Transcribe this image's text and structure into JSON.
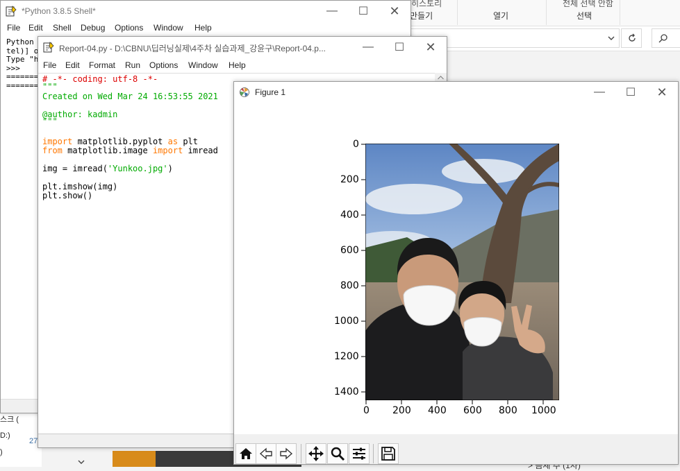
{
  "explorer": {
    "ribbon_groups": [
      "만들기",
      "열기",
      "선택"
    ],
    "ribbon_top_items": [
      "히스토리",
      "전체 선택 안함"
    ],
    "left_items": [
      "스크 (",
      "D:)",
      ")"
    ],
    "status_partial": "27",
    "bottom_right_partial": "> 음체 추 (1차)"
  },
  "shell": {
    "title": "*Python 3.8.5 Shell*",
    "menu": [
      "File",
      "Edit",
      "Shell",
      "Debug",
      "Options",
      "Window",
      "Help"
    ],
    "lines": [
      "Python",
      "tel)] o",
      "Type \"h",
      ">>> ",
      "=======",
      "======="
    ]
  },
  "editor": {
    "title": "Report-04.py - D:\\CBNU\\딥러닝실제\\4주차 실습과제_강윤구\\Report-04.p...",
    "menu": [
      "File",
      "Edit",
      "Format",
      "Run",
      "Options",
      "Window",
      "Help"
    ],
    "code": {
      "l1": "# -*- coding: utf-8 -*-",
      "l2": "\"\"\"",
      "l3": "Created on Wed Mar 24 16:53:55 2021",
      "l4": "@author: kadmin",
      "l5": "\"\"\"",
      "l6_kw": "import",
      "l6_rest": " matplotlib.pyplot ",
      "l6_kw2": "as",
      "l6_rest2": " plt",
      "l7_kw": "from",
      "l7_rest": " matplotlib.image ",
      "l7_kw2": "import",
      "l7_rest2": " imread",
      "l8_a": "img = imread(",
      "l8_str": "'Yunkoo.jpg'",
      "l8_b": ")",
      "l9": "plt.imshow(img)",
      "l10": "plt.show()"
    }
  },
  "figure": {
    "title": "Figure 1",
    "image_alt": "Photo: two people wearing white face masks in front of a large bare tree and hills",
    "y_ticks": [
      "0",
      "200",
      "400",
      "600",
      "800",
      "1000",
      "1200",
      "1400"
    ],
    "x_ticks": [
      "0",
      "200",
      "400",
      "600",
      "800",
      "1000"
    ],
    "toolbar": [
      "home-icon",
      "back-icon",
      "forward-icon",
      "pan-icon",
      "zoom-icon",
      "configure-icon",
      "save-icon"
    ]
  },
  "colors": {
    "idle_keyword": "#ff7700",
    "idle_string": "#00aa00",
    "idle_comment": "#dd0000",
    "accent_orange": "#d88b1a"
  }
}
